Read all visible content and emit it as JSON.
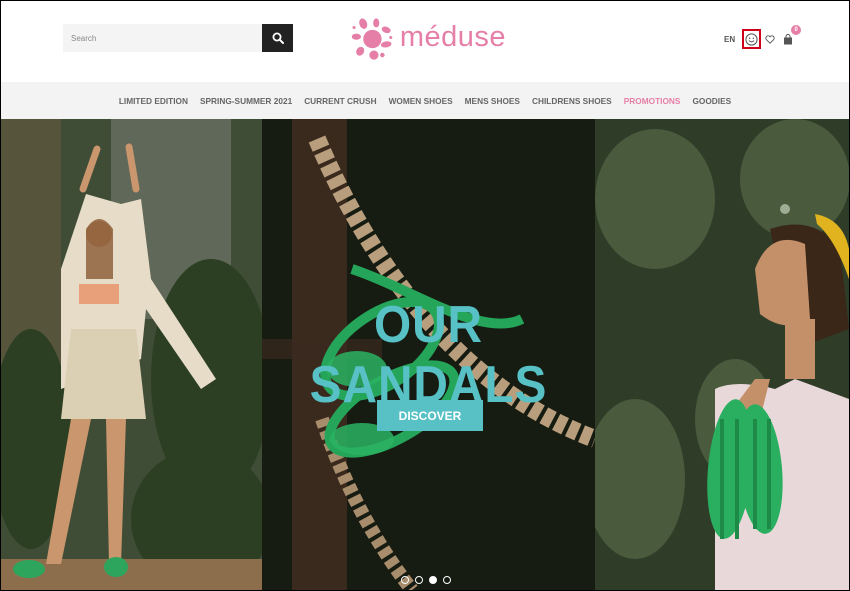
{
  "search": {
    "placeholder": "Search"
  },
  "brand": {
    "name": "méduse",
    "color": "#e57fa7"
  },
  "header": {
    "language": "EN",
    "cart_count": "0"
  },
  "nav": {
    "items": [
      {
        "label": "LIMITED EDITION"
      },
      {
        "label": "SPRING-SUMMER 2021"
      },
      {
        "label": "CURRENT CRUSH"
      },
      {
        "label": "WOMEN SHOES"
      },
      {
        "label": "MENS SHOES"
      },
      {
        "label": "CHILDRENS SHOES"
      },
      {
        "label": "PROMOTIONS"
      },
      {
        "label": "GOODIES"
      }
    ]
  },
  "hero": {
    "title": "OUR SANDALS",
    "button_label": "DISCOVER",
    "accent_color": "#57c1c6",
    "slides": 4,
    "active_slide": 3
  },
  "icons": {
    "search": "search-icon",
    "account": "smiley-icon",
    "wishlist": "heart-icon",
    "cart": "bag-icon"
  }
}
